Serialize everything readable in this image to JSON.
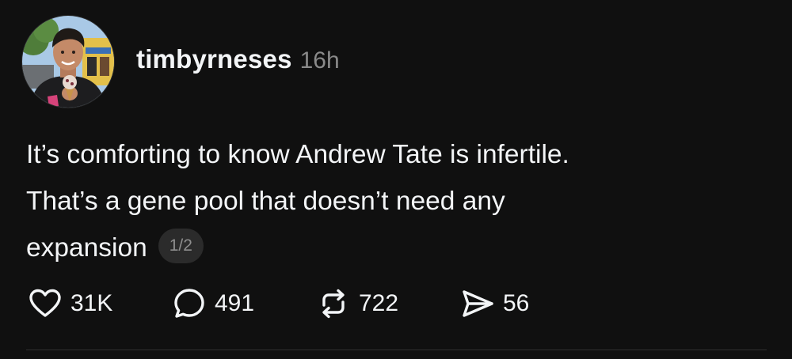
{
  "post": {
    "username": "timbyrneses",
    "timestamp": "16h",
    "text_lines": [
      "It’s comforting to know Andrew Tate is infertile.",
      "That’s a gene pool that doesn’t need any",
      "expansion"
    ],
    "page_indicator": "1/2"
  },
  "actions": {
    "like": {
      "icon": "heart-icon",
      "count": "31K"
    },
    "reply": {
      "icon": "comment-icon",
      "count": "491"
    },
    "repost": {
      "icon": "repost-icon",
      "count": "722"
    },
    "share": {
      "icon": "send-icon",
      "count": "56"
    }
  },
  "colors": {
    "background": "#101010",
    "primary_text": "#f3f5f7",
    "secondary_text": "#8a8a8a",
    "badge_background": "#2b2b2b",
    "divider": "#2f2f2f"
  }
}
